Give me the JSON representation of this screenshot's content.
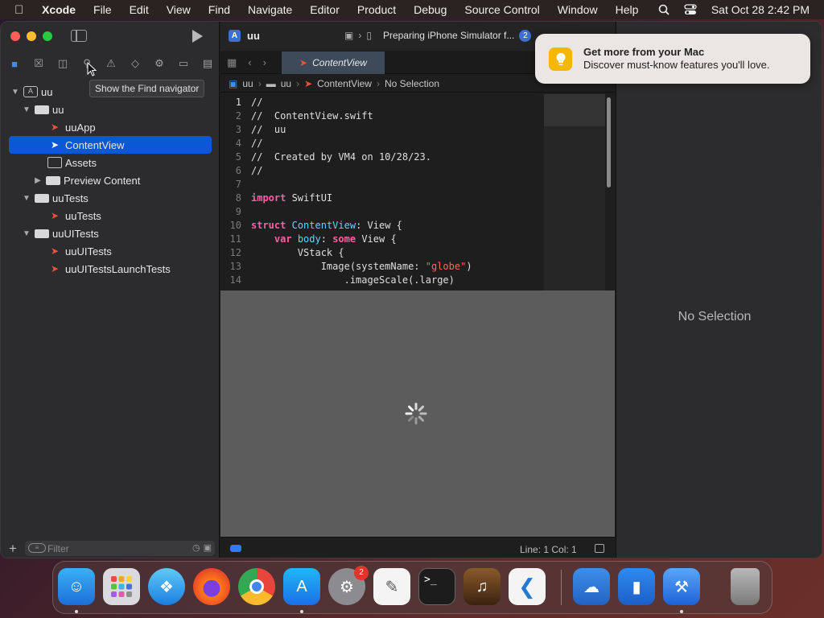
{
  "menubar": {
    "app": "Xcode",
    "items": [
      "File",
      "Edit",
      "View",
      "Find",
      "Navigate",
      "Editor",
      "Product",
      "Debug",
      "Source Control",
      "Window",
      "Help"
    ],
    "clock": "Sat Oct 28  2:42 PM"
  },
  "toolbar": {
    "project": "uu",
    "status": "Preparing iPhone Simulator f...",
    "status_badge": "2"
  },
  "tooltip": "Show the Find navigator",
  "navigator": {
    "tree": [
      {
        "label": "uu",
        "level": 0,
        "type": "project",
        "expanded": true
      },
      {
        "label": "uu",
        "level": 1,
        "type": "folder",
        "expanded": true
      },
      {
        "label": "uuApp",
        "level": 2,
        "type": "swift"
      },
      {
        "label": "ContentView",
        "level": 2,
        "type": "swift",
        "selected": true
      },
      {
        "label": "Assets",
        "level": 2,
        "type": "assets"
      },
      {
        "label": "Preview Content",
        "level": 2,
        "type": "folder",
        "expanded": false
      },
      {
        "label": "uuTests",
        "level": 1,
        "type": "folder",
        "expanded": true
      },
      {
        "label": "uuTests",
        "level": 2,
        "type": "swift"
      },
      {
        "label": "uuUITests",
        "level": 1,
        "type": "folder",
        "expanded": true
      },
      {
        "label": "uuUITests",
        "level": 2,
        "type": "swift"
      },
      {
        "label": "uuUITestsLaunchTests",
        "level": 2,
        "type": "swift"
      }
    ],
    "filter_placeholder": "Filter"
  },
  "editor": {
    "tab": "ContentView",
    "breadcrumb": [
      "uu",
      "uu",
      "ContentView",
      "No Selection"
    ],
    "code": [
      {
        "n": "1",
        "t": "//",
        "k": "cm"
      },
      {
        "n": "2",
        "t": "//  ContentView.swift",
        "k": "cm"
      },
      {
        "n": "3",
        "t": "//  uu",
        "k": "cm"
      },
      {
        "n": "4",
        "t": "//",
        "k": "cm"
      },
      {
        "n": "5",
        "t": "//  Created by VM4 on 10/28/23.",
        "k": "cm"
      },
      {
        "n": "6",
        "t": "//",
        "k": "cm"
      },
      {
        "n": "7",
        "t": "",
        "k": "cm"
      },
      {
        "n": "8",
        "t": "import SwiftUI",
        "k": "import"
      },
      {
        "n": "9",
        "t": "",
        "k": "cm"
      },
      {
        "n": "10",
        "t": "struct ContentView: View {",
        "k": "struct"
      },
      {
        "n": "11",
        "t": "    var body: some View {",
        "k": "var"
      },
      {
        "n": "12",
        "t": "        VStack {",
        "k": "plain"
      },
      {
        "n": "13",
        "t": "            Image(systemName: \"globe\")",
        "k": "image"
      },
      {
        "n": "14",
        "t": "                .imageScale(.large)",
        "k": "plain"
      }
    ],
    "cursor_position": "Line: 1  Col: 1"
  },
  "inspector": {
    "empty_label": "No Selection"
  },
  "notification": {
    "title": "Get more from your Mac",
    "body": "Discover must-know features you'll love."
  },
  "dock": {
    "apps": [
      "Finder",
      "Launchpad",
      "Safari",
      "Firefox",
      "Chrome",
      "App Store",
      "System Settings",
      "TextEdit",
      "Terminal",
      "GarageBand",
      "Visual Studio Code",
      "Weather",
      "Keynote",
      "Xcode",
      "Trash"
    ],
    "settings_badge": "2"
  }
}
